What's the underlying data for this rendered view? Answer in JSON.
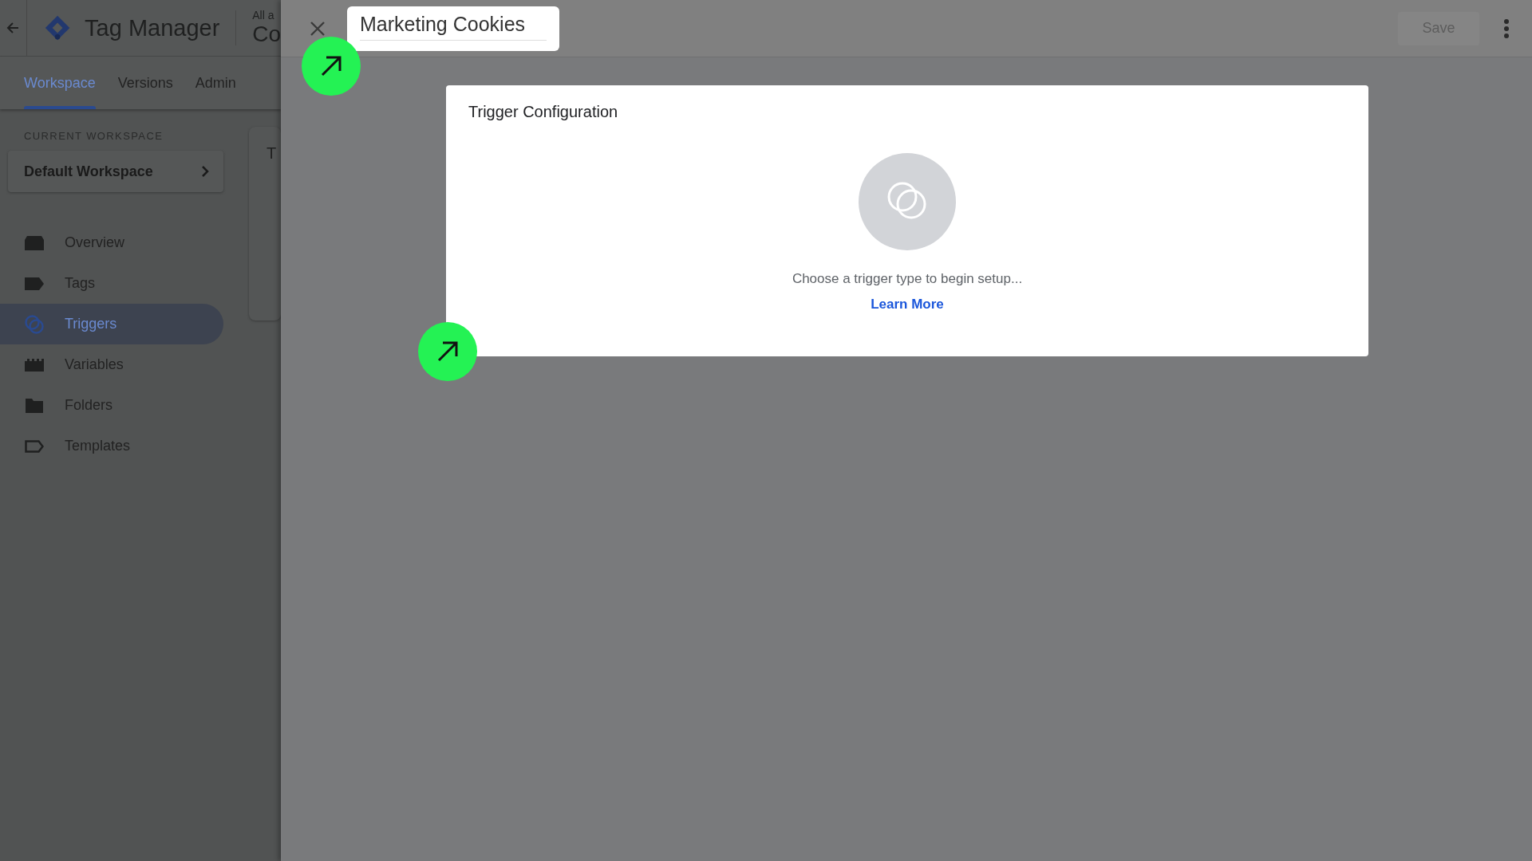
{
  "app": {
    "product_name": "Tag Manager",
    "container_path": "All a",
    "container_name": "Co"
  },
  "tabs": [
    {
      "label": "Workspace",
      "selected": true
    },
    {
      "label": "Versions",
      "selected": false
    },
    {
      "label": "Admin",
      "selected": false
    }
  ],
  "sidebar": {
    "section_label": "CURRENT WORKSPACE",
    "workspace": "Default Workspace",
    "items": [
      {
        "label": "Overview",
        "selected": false
      },
      {
        "label": "Tags",
        "selected": false
      },
      {
        "label": "Triggers",
        "selected": true
      },
      {
        "label": "Variables",
        "selected": false
      },
      {
        "label": "Folders",
        "selected": false
      },
      {
        "label": "Templates",
        "selected": false
      }
    ]
  },
  "background_card": {
    "title": "T"
  },
  "panel": {
    "name_value": "Marketing Cookies",
    "save_label": "Save",
    "save_disabled": true,
    "card": {
      "title": "Trigger Configuration",
      "hint": "Choose a trigger type to begin setup...",
      "link": "Learn More"
    }
  },
  "annotations": [
    {
      "kind": "arrow"
    },
    {
      "kind": "arrow"
    }
  ]
}
